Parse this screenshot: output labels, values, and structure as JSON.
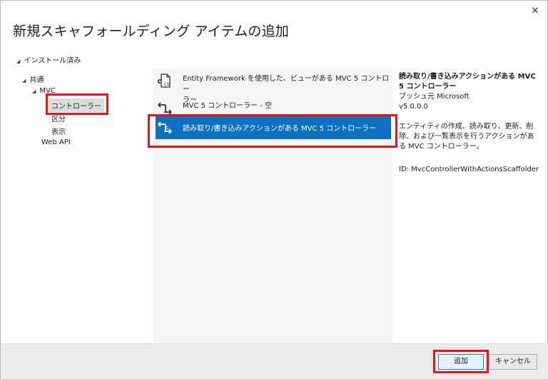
{
  "dialog": {
    "title": "新規スキャフォールディング アイテムの追加",
    "close_glyph": "✕"
  },
  "tree": {
    "header": "インストール済み",
    "items": [
      {
        "label": "共通"
      },
      {
        "label": "MVC"
      },
      {
        "label": "コントローラー"
      },
      {
        "label": "区分"
      },
      {
        "label": "表示"
      },
      {
        "label": "Web API"
      }
    ],
    "expand_glyph": "◢",
    "selected": "コントローラー"
  },
  "templates": [
    {
      "label_line1": "Entity Framework を使用した、ビューがある MVC 5 コントロー",
      "label_line2": "ラー",
      "icon": "scaffold-ef-icon"
    },
    {
      "label_line1": "MVC 5 コントローラー - 空",
      "label_line2": "",
      "icon": "scaffold-controller-icon"
    },
    {
      "label_line1": "読み取り/書き込みアクションがある MVC 5 コントローラー",
      "label_line2": "",
      "icon": "scaffold-controller-rw-icon",
      "selected": true
    }
  ],
  "details": {
    "title_line1": "読み取り/書き込みアクションがある MVC",
    "title_line2": "5 コントローラー",
    "publisher": "プッシュ元 Microsoft",
    "version": "v5.0.0.0",
    "desc_line1": "エンティティの作成、読み取り、更新、削",
    "desc_line2": "除、および一覧表示を行うアクションがあ",
    "desc_line3": "る MVC コントローラー。",
    "id": "ID: MvcControllerWithActionsScaffolder"
  },
  "buttons": {
    "add": "追加",
    "cancel": "キャンセル"
  },
  "colors": {
    "selection": "#0e70c0",
    "highlight_box": "#e0161b",
    "center_panel_bg": "#f5f5f5",
    "footer_bg": "#ececec"
  }
}
